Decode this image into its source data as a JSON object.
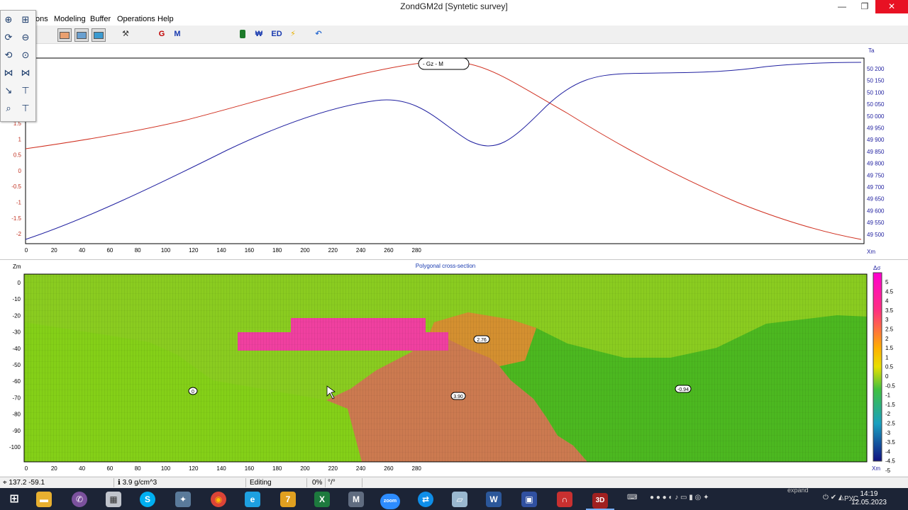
{
  "window": {
    "title": "ZondGM2d [Syntetic survey]",
    "btn_min": "—",
    "btn_max": "❐",
    "btn_close": "✕"
  },
  "menu": {
    "items": [
      "ons",
      "Modeling",
      "Buffer",
      "Operations",
      "Help"
    ]
  },
  "toolbar": {
    "g_label": "G",
    "m_label": "M",
    "ed_label": "ED"
  },
  "top_chart": {
    "legend_text": "- Gz  - M",
    "right_unit": "Ta",
    "x_unit": "Xm",
    "left_ticks": [
      "1.5",
      "1",
      "0.5",
      "0",
      "-0.5",
      "-1",
      "-1.5",
      "-2"
    ],
    "right_ticks": [
      "50 200",
      "50 150",
      "50 100",
      "50 050",
      "50 000",
      "49 950",
      "49 900",
      "49 850",
      "49 800",
      "49 750",
      "49 700",
      "49 650",
      "49 600",
      "49 550",
      "49 500"
    ],
    "x_ticks": [
      "0",
      "20",
      "40",
      "60",
      "80",
      "100",
      "120",
      "140",
      "160",
      "180",
      "200",
      "220",
      "240",
      "260",
      "280"
    ]
  },
  "section": {
    "title": "Polygonal cross-section",
    "z_unit": "Zm",
    "x_unit": "Xm",
    "z_ticks": [
      "0",
      "-10",
      "-20",
      "-30",
      "-40",
      "-50",
      "-60",
      "-70",
      "-80",
      "-90",
      "-100"
    ],
    "x_ticks": [
      "0",
      "20",
      "40",
      "60",
      "80",
      "100",
      "120",
      "140",
      "160",
      "180",
      "200",
      "220",
      "240",
      "260",
      "280"
    ],
    "labels": {
      "left": "0",
      "upper_body": "2.76",
      "lower_body": "3.90",
      "right": "-0.94"
    },
    "scale_title": "Δσ",
    "scale_ticks": [
      "5",
      "4.5",
      "4",
      "3.5",
      "3",
      "2.5",
      "2",
      "1.5",
      "1",
      "0.5",
      "0",
      "-0.5",
      "-1",
      "-1.5",
      "-2",
      "-2.5",
      "-3",
      "-3.5",
      "-4",
      "-4.5",
      "-5"
    ]
  },
  "status": {
    "coords": "137.2 -59.1",
    "density": "3.9 g/cm^3",
    "mode": "Editing",
    "progress": "0%",
    "extra": "°/°"
  },
  "taskbar": {
    "zoom_label": "zoom",
    "lang": "РУС",
    "time": "14:19",
    "date": "12.05.2023",
    "tooltip": "expand"
  }
}
